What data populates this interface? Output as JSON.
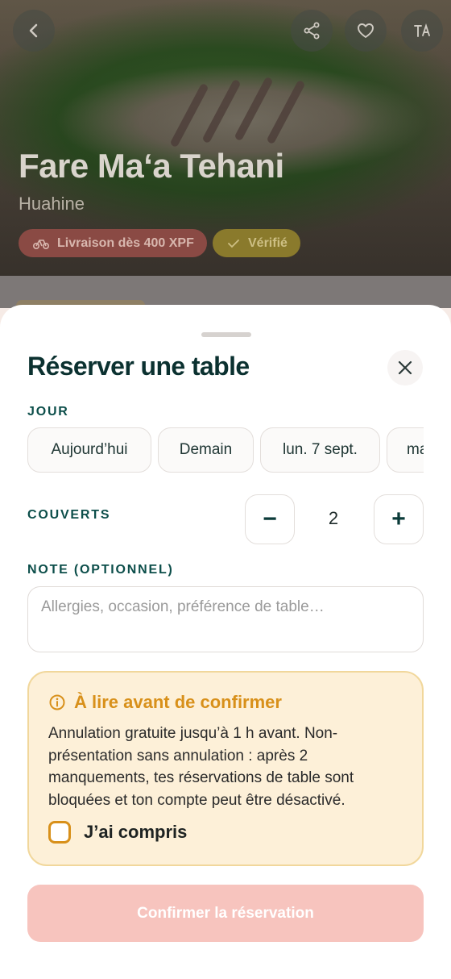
{
  "hero": {
    "title": "Fare Ma‘a Tehani",
    "subtitle": "Huahine",
    "badges": {
      "delivery": "Livraison dès 400 XPF",
      "verified": "Vérifié"
    },
    "icons": [
      "chevron-left-icon",
      "share-icon",
      "heart-icon",
      "translate-icon"
    ]
  },
  "sheet": {
    "title": "Réserver une table",
    "day_label": "JOUR",
    "days": [
      "Aujourd’hui",
      "Demain",
      "lun. 7 sept.",
      "ma"
    ],
    "guests_label": "COUVERTS",
    "guests": {
      "value": "2",
      "decrement": "−",
      "increment": "+"
    },
    "note_label": "NOTE (OPTIONNEL)",
    "note_placeholder": "Allergies, occasion, préférence de table…",
    "notice": {
      "title": "À lire avant de confirmer",
      "text": "Annulation gratuite jusqu’à 1 h avant. Non-présentation sans annulation : après 2 manquements, tes réservations de table sont bloquées et ton compte peut être désactivé.",
      "checkbox_label": "J’ai compris",
      "checked": false
    },
    "confirm_label": "Confirmer la réservation"
  },
  "colors": {
    "dark_teal": "#0b3130",
    "label_teal": "#0c4e4a",
    "warning_orange": "#d8901a",
    "warning_bg": "#fdf0d8",
    "confirm_disabled": "#f7c4be"
  }
}
